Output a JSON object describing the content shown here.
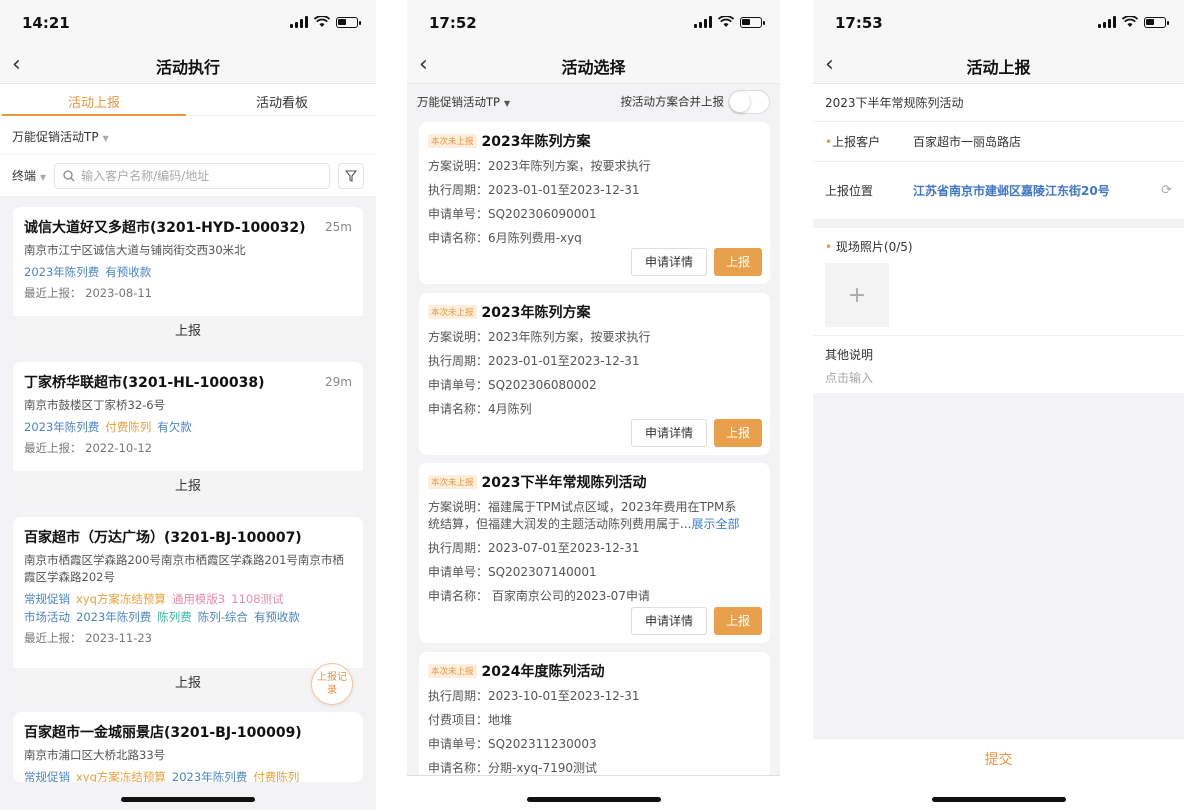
{
  "screen1": {
    "time": "14:21",
    "title": "活动执行",
    "tabs": [
      "活动上报",
      "活动看板"
    ],
    "activity_type": "万能促销活动TP",
    "terminal_label": "终端",
    "search_placeholder": "输入客户名称/编码/地址",
    "report_label": "上报",
    "float_button": "上报记录",
    "stores": [
      {
        "name": "诚信大道好又多超市(3201-HYD-100032)",
        "distance": "25m",
        "address": "南京市江宁区诚信大道与铺岗街交西30米北",
        "tags": [
          {
            "text": "2023年陈列费",
            "color": "blue"
          },
          {
            "text": "有预收款",
            "color": "blue"
          }
        ],
        "last_report": "最近上报： 2023-08-11"
      },
      {
        "name": "丁家桥华联超市(3201-HL-100038)",
        "distance": "29m",
        "address": "南京市鼓楼区丁家桥32-6号",
        "tags": [
          {
            "text": "2023年陈列费",
            "color": "blue"
          },
          {
            "text": "付费陈列",
            "color": "orange"
          },
          {
            "text": "有欠款",
            "color": "blue"
          }
        ],
        "last_report": "最近上报： 2022-10-12"
      },
      {
        "name": "百家超市（万达广场）(3201-BJ-100007)",
        "distance": "",
        "address": "南京市栖霞区学森路200号南京市栖霞区学森路201号南京市栖霞区学森路202号",
        "tags_row1": [
          {
            "text": "常规促销",
            "color": "blue"
          },
          {
            "text": "xyq方案冻结预算",
            "color": "orange"
          },
          {
            "text": "通用模版3",
            "color": "pink"
          },
          {
            "text": "1108测试",
            "color": "pink"
          }
        ],
        "tags_row2": [
          {
            "text": "市场活动",
            "color": "blue"
          },
          {
            "text": "2023年陈列费",
            "color": "blue"
          },
          {
            "text": "陈列费",
            "color": "teal"
          },
          {
            "text": "陈列-综合",
            "color": "blue"
          },
          {
            "text": "有预收款",
            "color": "blue"
          }
        ],
        "last_report": "最近上报： 2023-11-23"
      },
      {
        "name": "百家超市一金城丽景店(3201-BJ-100009)",
        "address": "南京市浦口区大桥北路33号",
        "tags": [
          {
            "text": "常规促销",
            "color": "blue"
          },
          {
            "text": "xyq方案冻结预算",
            "color": "orange"
          },
          {
            "text": "2023年陈列费",
            "color": "blue"
          },
          {
            "text": "付费陈列",
            "color": "orange"
          }
        ]
      }
    ]
  },
  "screen2": {
    "time": "17:52",
    "title": "活动选择",
    "activity_type": "万能促销活动TP",
    "merge_label": "按活动方案合并上报",
    "badge": "本次未上报",
    "detail_btn": "申请详情",
    "report_btn": "上报",
    "plans": [
      {
        "title": "2023年陈列方案",
        "lines": [
          "方案说明：2023年陈列方案，按要求执行",
          "执行周期：2023-01-01至2023-12-31",
          "申请单号：SQ202306090001",
          "申请名称：6月陈列费用-xyq"
        ]
      },
      {
        "title": "2023年陈列方案",
        "lines": [
          "方案说明：2023年陈列方案，按要求执行",
          "执行周期：2023-01-01至2023-12-31",
          "申请单号：SQ202306080002",
          "申请名称：4月陈列"
        ]
      },
      {
        "title": "2023下半年常规陈列活动",
        "desc1": "方案说明：福建属于TPM试点区域，2023年费用在TPM系",
        "desc2": "统结算，但福建大润发的主题活动陈列费用属于...",
        "more": "展示全部",
        "lines": [
          "执行周期：2023-07-01至2023-12-31",
          "申请单号：SQ202307140001",
          "申请名称： 百家南京公司的2023-07申请"
        ]
      },
      {
        "title": "2024年度陈列活动",
        "lines": [
          "执行周期：2023-10-01至2023-12-31",
          "付费项目：地堆",
          "申请单号：SQ202311230003",
          "申请名称：分期-xyq-7190测试"
        ]
      }
    ]
  },
  "screen3": {
    "time": "17:53",
    "title": "活动上报",
    "activity_name": "2023下半年常规陈列活动",
    "customer_label": "上报客户",
    "customer_value": "百家超市一丽岛路店",
    "location_label": "上报位置",
    "location_value": "江苏省南京市建邺区嘉陵江东街20号",
    "photo_label": "现场照片(0/5)",
    "other_label": "其他说明",
    "other_placeholder": "点击输入",
    "submit": "提交"
  },
  "colors": {
    "accent": "#e8973f",
    "blue": "#4a84c6",
    "orange": "#e8a23a",
    "pink": "#e68da6",
    "teal": "#36b8a8"
  }
}
